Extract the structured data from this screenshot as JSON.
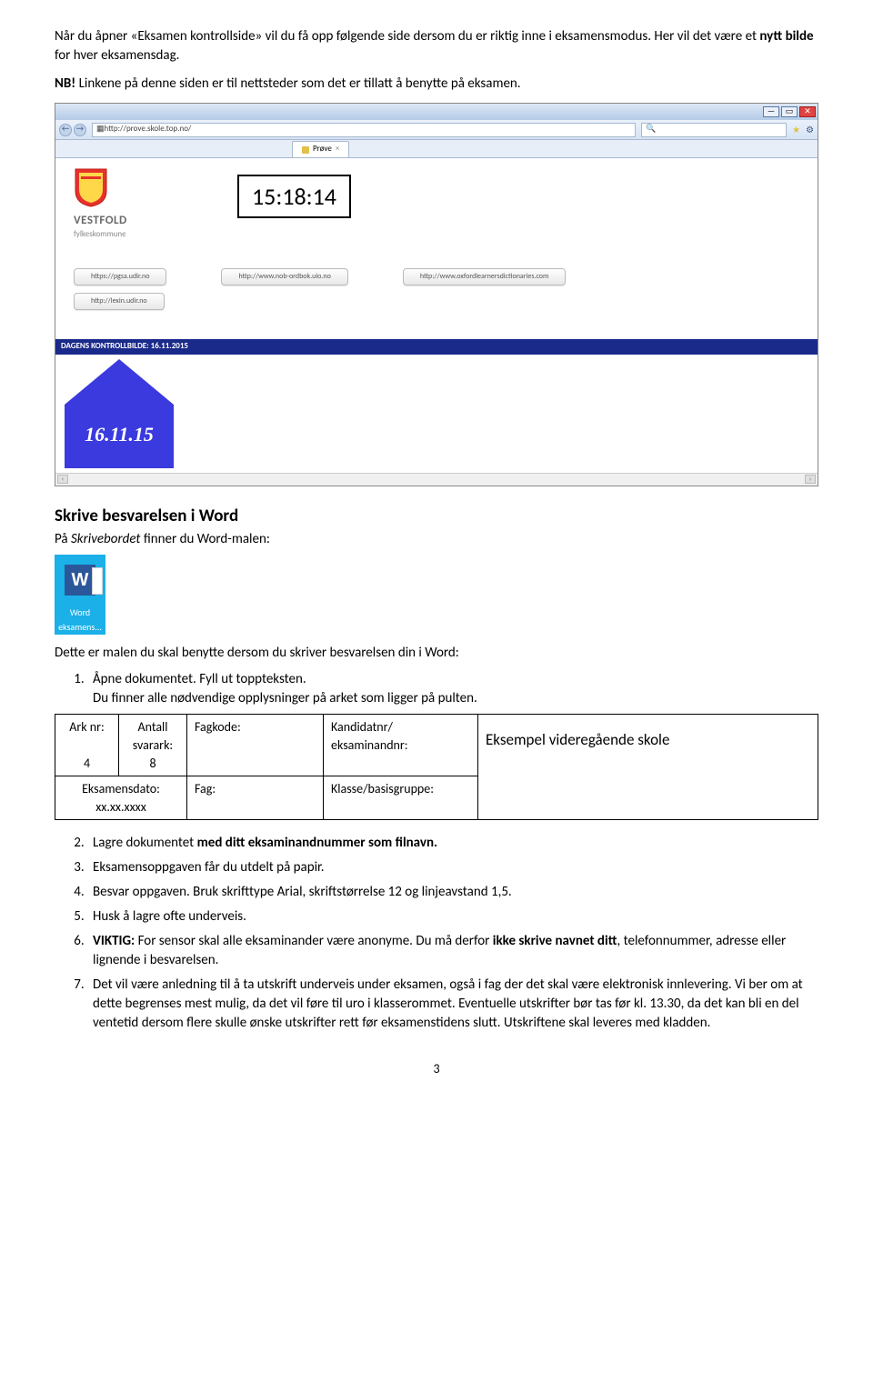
{
  "intro": {
    "line1a": "Når du åpner «Eksamen kontrollside» vil du få opp følgende side dersom du er riktig inne i eksamensmodus. Her vil det være et ",
    "line1b_bold": "nytt bilde",
    "line1c": " for hver eksamensdag.",
    "line2_bold": "NB!",
    "line2_rest": " Linkene på denne siden er til nettsteder som det er tillatt å benytte på eksamen."
  },
  "browser": {
    "url": "http://prove.skole.top.no/",
    "tab_label": "Prøve",
    "logo_main": "VESTFOLD",
    "logo_sub": "fylkeskommune",
    "clock": "15:18:14",
    "links": [
      "https://pgsa.udir.no",
      "http://www.nob-ordbok.uio.no",
      "http://www.oxfordlearnersdictionaries.com",
      "http://lexin.udir.no"
    ],
    "dagens": "DAGENS KONTROLLBILDE: 16.11.2015",
    "house_date": "16.11.15"
  },
  "word_section": {
    "heading": "Skrive besvarelsen i Word",
    "subline_a": "På ",
    "subline_b_italic": "Skrivebordet",
    "subline_c": " finner du Word-malen:",
    "tile_letter": "W",
    "tile_label1": "Word",
    "tile_label2": "eksamens...",
    "after_icon": "Dette er malen du skal benytte dersom du skriver besvarelsen din i Word:",
    "step1a": "Åpne dokumentet. Fyll ut toppteksten.",
    "step1b": "Du finner alle nødvendige opplysninger på arket som ligger på pulten."
  },
  "table": {
    "r1c1_l1": "Ark nr:",
    "r1c1_l2": "4",
    "r1c2_l1": "Antall",
    "r1c2_l2": "svarark:",
    "r1c2_l3": "8",
    "r1c3": "Fagkode:",
    "r1c4_l1": "Kandidatnr/",
    "r1c4_l2": "eksaminandnr:",
    "r1c5": "Eksempel videregående skole",
    "r2c1_l1": "Eksamensdato:",
    "r2c1_l2": "xx.xx.xxxx",
    "r2c2": "Fag:",
    "r2c3": "Klasse/basisgruppe:"
  },
  "steps2": {
    "s2a": "Lagre dokumentet ",
    "s2b_bold": "med ditt eksaminandnummer som filnavn.",
    "s3": "Eksamensoppgaven får du utdelt på papir.",
    "s4": "Besvar oppgaven. Bruk skrifttype Arial, skriftstørrelse 12 og linjeavstand 1,5.",
    "s5": "Husk å lagre ofte underveis.",
    "s6_bold": "VIKTIG:",
    "s6_rest": " For sensor skal alle eksaminander være anonyme. Du må derfor ",
    "s6_bold2": "ikke skrive navnet ditt",
    "s6_rest2": ", telefonnummer, adresse eller lignende i besvarelsen.",
    "s7": "Det vil være anledning til å ta utskrift underveis under eksamen, også i fag der det skal være elektronisk innlevering. Vi ber om at dette begrenses mest mulig, da det vil føre til uro i klasserommet. Eventuelle utskrifter bør tas før kl. 13.30, da det kan bli en del ventetid dersom flere skulle ønske utskrifter rett før eksamenstidens slutt. Utskriftene skal leveres med kladden."
  },
  "page_number": "3"
}
